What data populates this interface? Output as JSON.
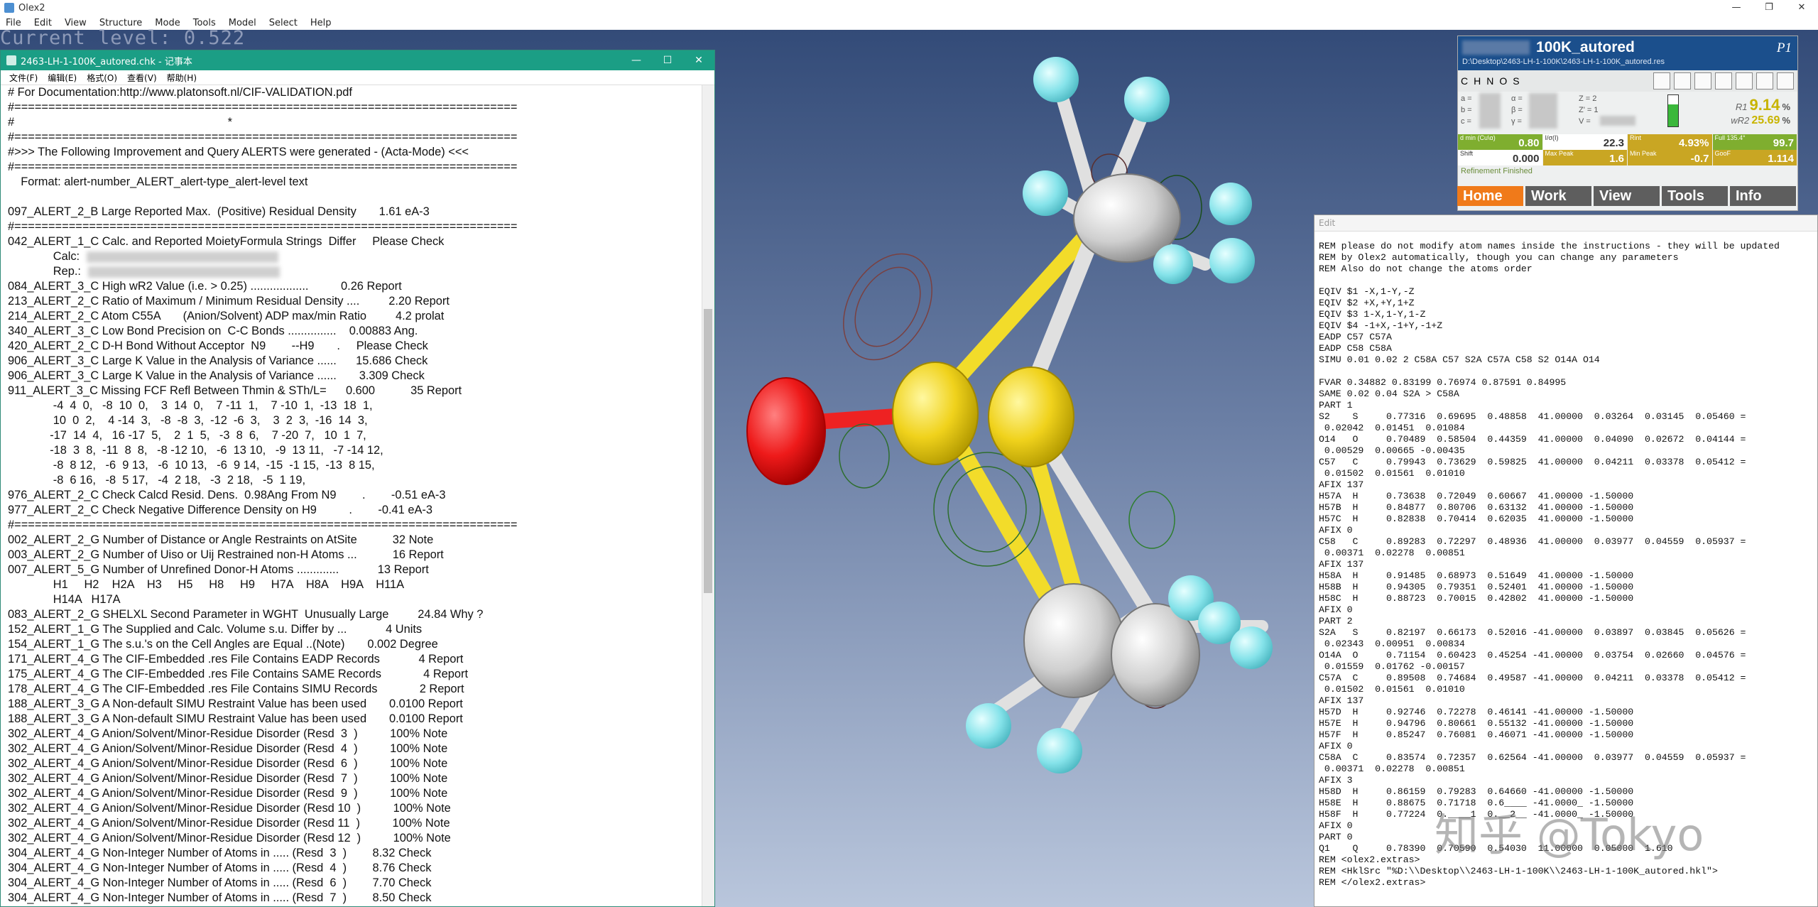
{
  "app": {
    "title": "Olex2",
    "menu": [
      "File",
      "Edit",
      "View",
      "Structure",
      "Mode",
      "Tools",
      "Model",
      "Select",
      "Help"
    ],
    "window_buttons": [
      "—",
      "❐",
      "✕"
    ]
  },
  "viewport": {
    "level_text": "Current level: 0.522"
  },
  "notepad": {
    "title": "2463-LH-1-100K_autored.chk - 记事本",
    "menu": [
      "文件(F)",
      "编辑(E)",
      "格式(O)",
      "查看(V)",
      "帮助(H)"
    ],
    "window_buttons": [
      "—",
      "☐",
      "✕"
    ],
    "lines": [
      "# For Documentation:http://www.platonsoft.nl/CIF-VALIDATION.pdf",
      "#==========================================================================",
      "#                                                                  *",
      "#==========================================================================",
      "#>>> The Following Improvement and Query ALERTS were generated - (Acta-Mode) <<<",
      "#==========================================================================",
      "    Format: alert-number_ALERT_alert-type_alert-level text",
      "",
      "097_ALERT_2_B Large Reported Max.  (Positive) Residual Density       1.61 eA-3",
      "#==========================================================================",
      "042_ALERT_1_C Calc. and Reported MoietyFormula Strings  Differ     Please Check",
      "              Calc:",
      "              Rep.:",
      "084_ALERT_3_C High wR2 Value (i.e. > 0.25) ..................          0.26 Report",
      "213_ALERT_2_C Ratio of Maximum / Minimum Residual Density ....         2.20 Report",
      "214_ALERT_2_C Atom C55A       (Anion/Solvent) ADP max/min Ratio         4.2 prolat",
      "340_ALERT_3_C Low Bond Precision on  C-C Bonds ...............    0.00883 Ang.",
      "420_ALERT_2_C D-H Bond Without Acceptor  N9        --H9       .     Please Check",
      "906_ALERT_3_C Large K Value in the Analysis of Variance ......      15.686 Check",
      "906_ALERT_3_C Large K Value in the Analysis of Variance ......       3.309 Check",
      "911_ALERT_3_C Missing FCF Refl Between Thmin & STh/L=      0.600           35 Report",
      "              -4  4  0,   -8  10  0,    3  14  0,    7 -11  1,    7 -10  1,  -13  18  1,",
      "              10  0  2,    4 -14  3,   -8  -8  3,  -12  -6  3,    3  2  3,  -16  14  3,",
      "             -17  14  4,   16 -17  5,    2  1  5,   -3  8  6,    7 -20  7,   10  1  7,",
      "             -18  3  8,  -11  8  8,   -8 -12 10,   -6  13 10,   -9  13 11,   -7 -14 12,",
      "              -8  8 12,   -6  9 13,   -6  10 13,   -6  9 14,  -15  -1 15,  -13  8 15,",
      "              -8  6 16,   -8  5 17,   -4  2 18,   -3  2 18,   -5  1 19,",
      "976_ALERT_2_C Check Calcd Resid. Dens.  0.98Ang From N9        .        -0.51 eA-3",
      "977_ALERT_2_C Check Negative Difference Density on H9          .        -0.41 eA-3",
      "#==========================================================================",
      "002_ALERT_2_G Number of Distance or Angle Restraints on AtSite           32 Note",
      "003_ALERT_2_G Number of Uiso or Uij Restrained non-H Atoms ...           16 Report",
      "007_ALERT_5_G Number of Unrefined Donor-H Atoms .............            13 Report",
      "              H1     H2    H2A    H3     H5     H8     H9     H7A    H8A    H9A    H11A",
      "              H14A   H17A",
      "083_ALERT_2_G SHELXL Second Parameter in WGHT  Unusually Large         24.84 Why ?",
      "152_ALERT_1_G The Supplied and Calc. Volume s.u. Differ by ...            4 Units",
      "154_ALERT_1_G The s.u.'s on the Cell Angles are Equal ..(Note)       0.002 Degree",
      "171_ALERT_4_G The CIF-Embedded .res File Contains EADP Records            4 Report",
      "175_ALERT_4_G The CIF-Embedded .res File Contains SAME Records             4 Report",
      "178_ALERT_4_G The CIF-Embedded .res File Contains SIMU Records             2 Report",
      "188_ALERT_3_G A Non-default SIMU Restraint Value has been used       0.0100 Report",
      "188_ALERT_3_G A Non-default SIMU Restraint Value has been used       0.0100 Report",
      "302_ALERT_4_G Anion/Solvent/Minor-Residue Disorder (Resd  3  )          100% Note",
      "302_ALERT_4_G Anion/Solvent/Minor-Residue Disorder (Resd  4  )          100% Note",
      "302_ALERT_4_G Anion/Solvent/Minor-Residue Disorder (Resd  6  )          100% Note",
      "302_ALERT_4_G Anion/Solvent/Minor-Residue Disorder (Resd  7  )          100% Note",
      "302_ALERT_4_G Anion/Solvent/Minor-Residue Disorder (Resd  9  )          100% Note",
      "302_ALERT_4_G Anion/Solvent/Minor-Residue Disorder (Resd 10  )          100% Note",
      "302_ALERT_4_G Anion/Solvent/Minor-Residue Disorder (Resd 11  )          100% Note",
      "302_ALERT_4_G Anion/Solvent/Minor-Residue Disorder (Resd 12  )          100% Note",
      "304_ALERT_4_G Non-Integer Number of Atoms in ..... (Resd  3  )        8.32 Check",
      "304_ALERT_4_G Non-Integer Number of Atoms in ..... (Resd  4  )        8.76 Check",
      "304_ALERT_4_G Non-Integer Number of Atoms in ..... (Resd  6  )        7.70 Check",
      "304_ALERT_4_G Non-Integer Number of Atoms in ..... (Resd  7  )        8.50 Check"
    ]
  },
  "panel": {
    "title": "100K_autored",
    "space_group": "P1",
    "path": "D:\\Desktop\\2463-LH-1-100K\\2463-LH-1-100K_autored.res",
    "elements": [
      "C",
      "H",
      "N",
      "O",
      "S"
    ],
    "cell_labels": [
      "a =",
      "b =",
      "c =",
      "α =",
      "β =",
      "γ =",
      "Z = 2",
      "Z' = 1",
      "V ="
    ],
    "r1_label": "R1",
    "r1_value": "9.14",
    "r1_unit": "%",
    "wr2_label": "wR2",
    "wr2_value": "25.69",
    "wr2_unit": "%",
    "stats_row1": [
      {
        "label": "d min (Cu\\α)",
        "value": "0.80"
      },
      {
        "label": "I/σ(I)",
        "value": "22.3"
      },
      {
        "label": "Rint",
        "value": "4.93%"
      },
      {
        "label": "Full 135.4°",
        "value": "99.7"
      }
    ],
    "stats_row2": [
      {
        "label": "Shift",
        "value": "0.000"
      },
      {
        "label": "Max Peak",
        "value": "1.6"
      },
      {
        "label": "Min Peak",
        "value": "-0.7"
      },
      {
        "label": "GooF",
        "value": "1.114"
      }
    ],
    "status": "Refinement Finished",
    "tabs": [
      "Home",
      "Work",
      "View",
      "Tools",
      "Info"
    ]
  },
  "editor": {
    "title": "Edit",
    "lines": [
      "REM please do not modify atom names inside the instructions - they will be updated",
      "REM by Olex2 automatically, though you can change any parameters",
      "REM Also do not change the atoms order",
      "",
      "EQIV $1 -X,1-Y,-Z",
      "EQIV $2 +X,+Y,1+Z",
      "EQIV $3 1-X,1-Y,1-Z",
      "EQIV $4 -1+X,-1+Y,-1+Z",
      "EADP C57 C57A",
      "EADP C58 C58A",
      "SIMU 0.01 0.02 2 C58A C57 S2A C57A C58 S2 O14A O14",
      "",
      "FVAR 0.34882 0.83199 0.76974 0.87591 0.84995",
      "SAME 0.02 0.04 S2A > C58A",
      "PART 1",
      "S2    S     0.77316  0.69695  0.48858  41.00000  0.03264  0.03145  0.05460 =",
      " 0.02042  0.01451  0.01084",
      "O14   O     0.70489  0.58504  0.44359  41.00000  0.04090  0.02672  0.04144 =",
      " 0.00529  0.00665 -0.00435",
      "C57   C     0.79943  0.73629  0.59825  41.00000  0.04211  0.03378  0.05412 =",
      " 0.01502  0.01561  0.01010",
      "AFIX 137",
      "H57A  H     0.73638  0.72049  0.60667  41.00000 -1.50000",
      "H57B  H     0.84877  0.80706  0.63132  41.00000 -1.50000",
      "H57C  H     0.82838  0.70414  0.62035  41.00000 -1.50000",
      "AFIX 0",
      "C58   C     0.89283  0.72297  0.48936  41.00000  0.03977  0.04559  0.05937 =",
      " 0.00371  0.02278  0.00851",
      "AFIX 137",
      "H58A  H     0.91485  0.68973  0.51649  41.00000 -1.50000",
      "H58B  H     0.94305  0.79351  0.52401  41.00000 -1.50000",
      "H58C  H     0.88723  0.70015  0.42802  41.00000 -1.50000",
      "AFIX 0",
      "PART 2",
      "S2A   S     0.82197  0.66173  0.52016 -41.00000  0.03897  0.03845  0.05626 =",
      " 0.02343  0.00951  0.00834",
      "O14A  O     0.71154  0.60423  0.45254 -41.00000  0.03754  0.02660  0.04576 =",
      " 0.01559  0.01762 -0.00157",
      "C57A  C     0.89508  0.74684  0.49587 -41.00000  0.04211  0.03378  0.05412 =",
      " 0.01502  0.01561  0.01010",
      "AFIX 137",
      "H57D  H     0.92746  0.72278  0.46141 -41.00000 -1.50000",
      "H57E  H     0.94796  0.80661  0.55132 -41.00000 -1.50000",
      "H57F  H     0.85247  0.76081  0.46071 -41.00000 -1.50000",
      "AFIX 0",
      "C58A  C     0.83574  0.72357  0.62564 -41.00000  0.03977  0.04559  0.05937 =",
      " 0.00371  0.02278  0.00851",
      "AFIX 3",
      "H58D  H     0.86159  0.79283  0.64660 -41.00000 -1.50000",
      "H58E  H     0.88675  0.71718  0.6____ -41.0000_ -1.50000",
      "H58F  H     0.77224  0.____1  0.__2__ -41.0000_ -1.50000",
      "AFIX 0",
      "PART 0",
      "Q1    Q     0.78390  0.70590  0.54030  11.00000  0.05000  1.610",
      "REM <olex2.extras>",
      "REM <HklSrc \"%D:\\\\Desktop\\\\2463-LH-1-100K\\\\2463-LH-1-100K_autored.hkl\">",
      "REM </olex2.extras>"
    ]
  },
  "watermark": "知乎 @Tokyo",
  "colors": {
    "notepad_title": "#1b9e85",
    "panel_head": "#1b4f8c",
    "tab_active": "#f07a1a",
    "r_values": "#c8b400"
  }
}
